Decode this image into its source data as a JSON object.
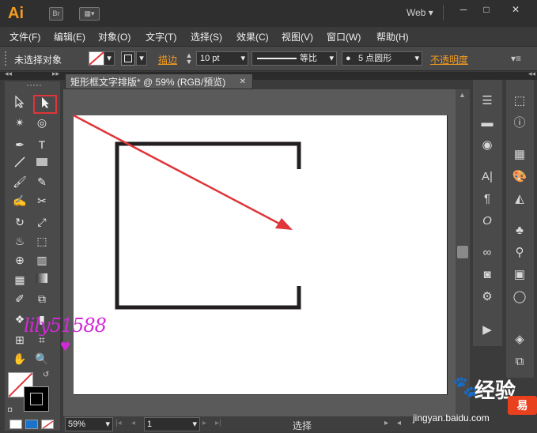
{
  "app": {
    "logo": "Ai",
    "bridge_label": "Br",
    "workspace": "Web",
    "win_minimize": "─",
    "win_maximize": "□",
    "win_close": "✕"
  },
  "menu": [
    "文件(F)",
    "编辑(E)",
    "对象(O)",
    "文字(T)",
    "选择(S)",
    "效果(C)",
    "视图(V)",
    "窗口(W)",
    "帮助(H)"
  ],
  "control_bar": {
    "selection_status": "未选择对象",
    "stroke_label": "描边",
    "stroke_weight": "10 pt",
    "stroke_profile": "等比",
    "brush": "5 点圆形",
    "opacity_label": "不透明度"
  },
  "document": {
    "tab_title": "矩形框文字排版* @ 59% (RGB/预览)",
    "close": "✕"
  },
  "status_bar": {
    "zoom": "59%",
    "artboard_number": "1",
    "tool_status": "选择"
  },
  "watermark": {
    "text": "lily51588",
    "baidu_text": "Bai",
    "baidu_cn": "经验",
    "url": "jingyan.baidu.com",
    "corner_logo": "易"
  },
  "colors": {
    "accent_orange": "#f49b1f",
    "highlight_red": "#e0353a",
    "watermark_magenta": "#d22ad6"
  },
  "tools": [
    "selection-tool",
    "direct-selection-tool",
    "magic-wand-tool",
    "lasso-tool",
    "pen-tool",
    "type-tool",
    "line-segment-tool",
    "rectangle-tool",
    "paintbrush-tool",
    "pencil-tool",
    "blob-brush-tool",
    "scissors-tool",
    "rotate-tool",
    "scale-tool",
    "warp-tool",
    "free-transform-tool",
    "shape-builder-tool",
    "graph-tool",
    "mesh-tool",
    "gradient-tool",
    "eyedropper-tool",
    "blend-tool",
    "symbol-sprayer-tool",
    "column-graph-tool",
    "artboard-tool",
    "slice-tool",
    "hand-tool",
    "zoom-tool"
  ],
  "tool_glyphs": {
    "type-tool": "T"
  }
}
